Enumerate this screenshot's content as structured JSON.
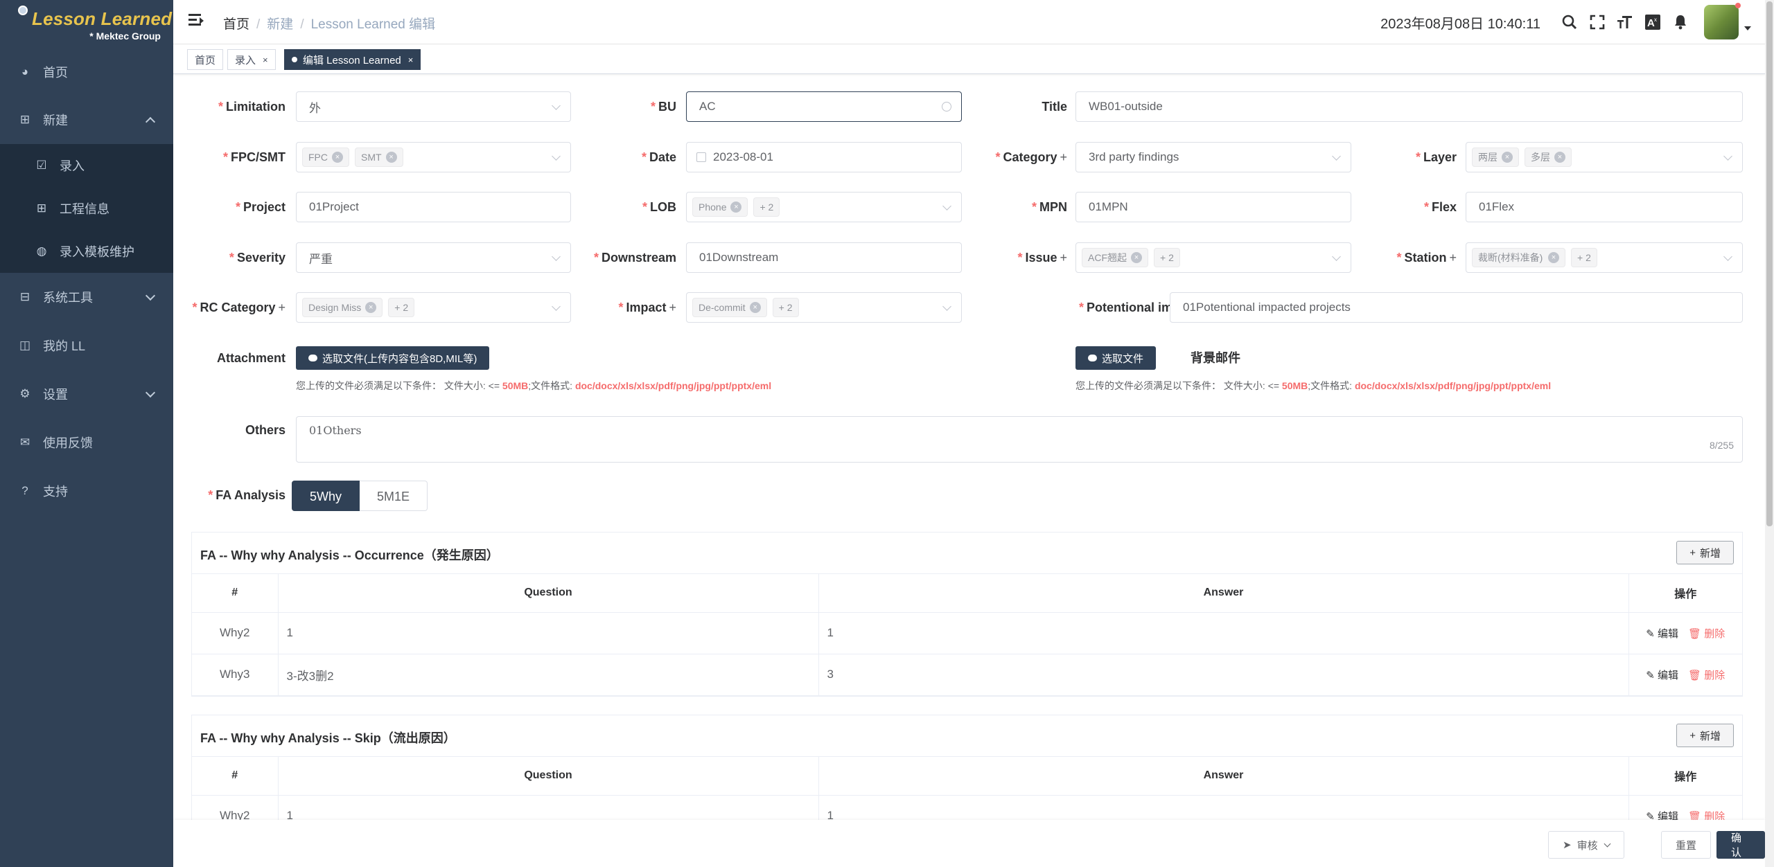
{
  "sidebar": {
    "logo_title": "Lesson Learned",
    "logo_subtitle": "* Mektec Group",
    "items": [
      {
        "label": "首页",
        "icon": "dashboard-icon"
      },
      {
        "label": "新建",
        "icon": "table-icon"
      },
      {
        "label": "录入",
        "icon": "checkbox-icon"
      },
      {
        "label": "工程信息",
        "icon": "grid-icon"
      },
      {
        "label": "录入模板维护",
        "icon": "globe-icon"
      },
      {
        "label": "系统工具",
        "icon": "toolbox-icon"
      },
      {
        "label": "我的 LL",
        "icon": "book-icon"
      },
      {
        "label": "设置",
        "icon": "gear-icon"
      },
      {
        "label": "使用反馈",
        "icon": "chat-icon"
      },
      {
        "label": "支持",
        "icon": "question-icon"
      }
    ]
  },
  "navbar": {
    "breadcrumb": [
      "首页",
      "新建",
      "Lesson Learned 编辑"
    ],
    "datetime": "2023年08月08日 10:40:11"
  },
  "tags": [
    "首页",
    "录入",
    "编辑 Lesson Learned"
  ],
  "form": {
    "limitation": {
      "label": "Limitation",
      "value": "外"
    },
    "bu": {
      "label": "BU",
      "value": "AC"
    },
    "title": {
      "label": "Title",
      "value": "WB01-outside"
    },
    "fpc_smt": {
      "label": "FPC/SMT",
      "chips": [
        "FPC",
        "SMT"
      ]
    },
    "date": {
      "label": "Date",
      "value": "2023-08-01"
    },
    "category": {
      "label": "Category",
      "value": "3rd party findings"
    },
    "layer": {
      "label": "Layer",
      "chips": [
        "两层",
        "多层"
      ]
    },
    "project": {
      "label": "Project",
      "value": "01Project"
    },
    "lob": {
      "label": "LOB",
      "chips": [
        "Phone",
        "+ 2"
      ]
    },
    "mpn": {
      "label": "MPN",
      "value": "01MPN"
    },
    "flex": {
      "label": "Flex",
      "value": "01Flex"
    },
    "severity": {
      "label": "Severity",
      "value": "严重"
    },
    "downstream": {
      "label": "Downstream",
      "value": "01Downstream"
    },
    "issue": {
      "label": "Issue",
      "chips": [
        "ACF翘起",
        "+ 2"
      ]
    },
    "station": {
      "label": "Station",
      "chips": [
        "裁断(材料准备)",
        "+ 2"
      ]
    },
    "rc_category": {
      "label": "RC Category",
      "chips": [
        "Design Miss",
        "+ 2"
      ]
    },
    "impact": {
      "label": "Impact",
      "chips": [
        "De-commit",
        "+ 2"
      ]
    },
    "potential": {
      "label": "Potentional impacted projects",
      "value": "01Potentional impacted projects"
    },
    "attachment": {
      "label": "Attachment",
      "button": "选取文件(上传内容包含8D,MIL等)"
    },
    "mail": {
      "label": "背景邮件",
      "button": "选取文件"
    },
    "tip_prefix": "您上传的文件必须满足以下条件： 文件大小: <=",
    "tip_size": "50MB",
    "tip_mid": ";文件格式:",
    "tip_formats": "doc/docx/xls/xlsx/pdf/png/jpg/ppt/pptx/eml",
    "others": {
      "label": "Others",
      "value": "01Others",
      "count": "8/255"
    },
    "fa": {
      "label": "FA Analysis",
      "options": [
        "5Why",
        "5M1E"
      ]
    }
  },
  "occurrence": {
    "title": "FA -- Why why Analysis -- Occurrence（発生原因）",
    "add": "新增",
    "headers": [
      "#",
      "Question",
      "Answer",
      "操作"
    ],
    "rows": [
      {
        "no": "Why2",
        "q": "1",
        "a": "1"
      },
      {
        "no": "Why3",
        "q": "3-改3删2",
        "a": "3"
      }
    ],
    "edit": "编辑",
    "del": "删除"
  },
  "skip": {
    "title": "FA -- Why why Analysis -- Skip（流出原因）",
    "add": "新增",
    "headers": [
      "#",
      "Question",
      "Answer",
      "操作"
    ],
    "rows": [
      {
        "no": "Why2",
        "q": "1",
        "a": "1"
      }
    ],
    "edit": "编辑",
    "del": "删除"
  },
  "footer": {
    "review": "审核",
    "reset": "重置",
    "confirm": "确认"
  }
}
